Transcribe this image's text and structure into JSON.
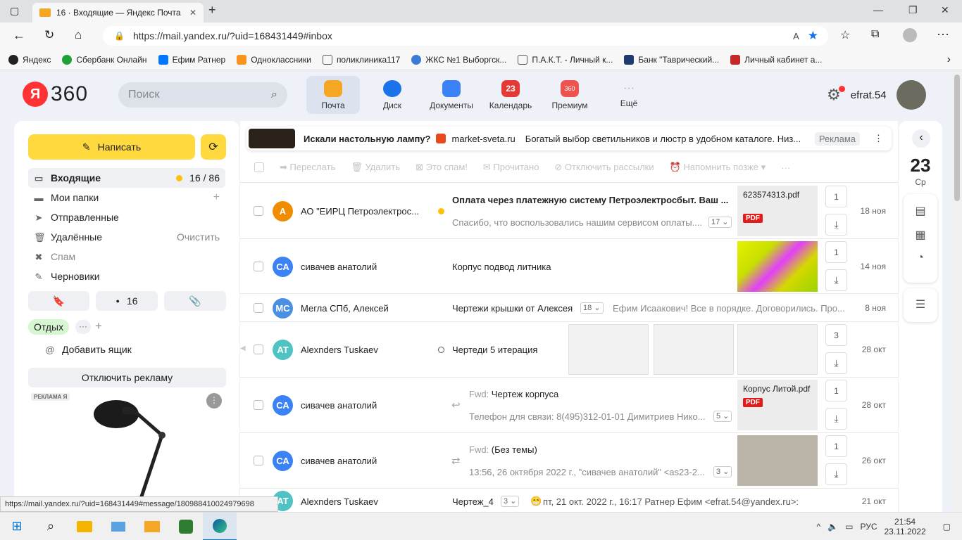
{
  "browser": {
    "tab_title": "16 · Входящие — Яндекс Почта",
    "url": "https://mail.yandex.ru/?uid=168431449#inbox",
    "bookmarks": [
      "Яндекс",
      "Сбербанк Онлайн",
      "Ефим Ратнер",
      "Одноклассники",
      "поликлиника117",
      "ЖКС №1 Выборгск...",
      "П.А.К.Т. - Личный к...",
      "Банк \"Таврический...",
      "Личный кабинет а..."
    ]
  },
  "header": {
    "logo_letter": "Я",
    "logo_text": "360",
    "search_placeholder": "Поиск",
    "username": "efrat.54",
    "services": [
      {
        "label": "Почта",
        "color": "#f5a623"
      },
      {
        "label": "Диск",
        "color": "#1a73e8"
      },
      {
        "label": "Документы",
        "color": "#3b82f6"
      },
      {
        "label": "Календарь",
        "badge": "23",
        "color": "#e53935"
      },
      {
        "label": "Премиум",
        "badge": "360",
        "color": "#ef5350"
      },
      {
        "label": "Ещё",
        "color": "#bbb"
      }
    ]
  },
  "sidebar": {
    "compose_label": "Написать",
    "folders": [
      {
        "label": "Входящие",
        "count": "16 / 86"
      },
      {
        "label": "Мои папки",
        "count": "+"
      },
      {
        "label": "Отправленные",
        "count": ""
      },
      {
        "label": "Удалённые",
        "count": "Очистить"
      },
      {
        "label": "Спам",
        "count": ""
      },
      {
        "label": "Черновики",
        "count": ""
      }
    ],
    "chip_count": "16",
    "label_tag": "Отдых",
    "add_mailbox": "Добавить ящик",
    "disable_ads": "Отключить рекламу",
    "ad_badge": "РЕКЛАМА Я"
  },
  "adline": {
    "text": "Искали настольную лампу?",
    "domain": "market-sveta.ru",
    "desc": "Богатый выбор светильников и люстр в удобном каталоге. Низ...",
    "tag": "Реклама"
  },
  "toolbar": [
    "Переслать",
    "Удалить",
    "Это спам!",
    "Прочитано",
    "Отключить рассылки",
    "Напомнить позже ▾",
    "···"
  ],
  "messages": [
    {
      "initials": "А",
      "color": "#f08c00",
      "from": "АО \"ЕИРЦ Петроэлектрос...",
      "subject": "Оплата через платежную систему Петроэлектросбыт. Ваш ...",
      "snippet": "Спасибо, что воспользовались нашим сервисом оплаты....",
      "count": "17",
      "attachment": "623574313.pdf",
      "att_count": "1",
      "date": "18 ноя"
    },
    {
      "initials": "СА",
      "color": "#3b82f6",
      "from": "сивачев анатолий",
      "subject": "Корпус подвод литника",
      "att_count": "1",
      "date": "14 ноя"
    },
    {
      "initials": "МС",
      "color": "#4a90e2",
      "from": "Мегла СПб, Алексей",
      "subject": "Чертежи крышки от Алексея",
      "count": "18",
      "snippet": "Ефим Исаакович! Все в порядке. Договорились. Про...",
      "date": "8 ноя"
    },
    {
      "initials": "AT",
      "color": "#4fc3c3",
      "from": "Alexnders Tuskaev",
      "subject": "Чертеди 5 итерация",
      "att_count": "3",
      "date": "28 окт"
    },
    {
      "initials": "СА",
      "color": "#3b82f6",
      "from": "сивачев анатолий",
      "fwd": "Fwd:",
      "subject": "Чертеж корпуса",
      "snippet": "Телефон для связи: 8(495)312-01-01 Димитриев Нико...",
      "count": "5",
      "attachment": "Корпус Литой.pdf",
      "att_count": "1",
      "date": "28 окт"
    },
    {
      "initials": "СА",
      "color": "#3b82f6",
      "from": "сивачев анатолий",
      "fwd": "Fwd:",
      "subject": "(Без темы)",
      "snippet": "13:56, 26 октября 2022 г., \"сивачев анатолий\" <as23-2...",
      "count": "3",
      "att_count": "1",
      "date": "26 окт"
    },
    {
      "initials": "AT",
      "color": "#4fc3c3",
      "from": "Alexnders Tuskaev",
      "subject": "Чертеж_4",
      "count": "3",
      "snippet": "пт, 21 окт. 2022 г., 16:17 Ратнер Ефим <efrat.54@yandex.ru>:",
      "date": "21 окт"
    }
  ],
  "rail": {
    "day": "23",
    "weekday": "Ср"
  },
  "pdf_label": "PDF",
  "status_url": "https://mail.yandex.ru/?uid=168431449#message/180988410024979698",
  "taskbar": {
    "lang": "РУС",
    "time": "21:54",
    "date": "23.11.2022"
  }
}
